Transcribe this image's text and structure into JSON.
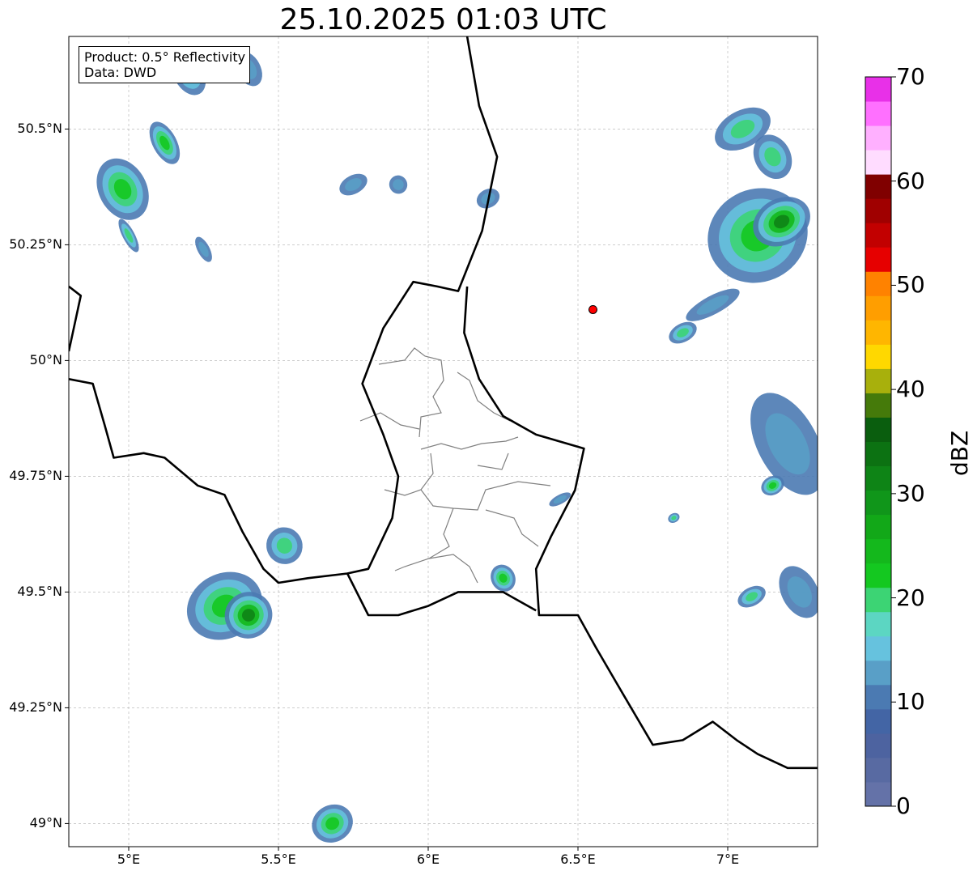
{
  "title": "25.10.2025 01:03 UTC",
  "legend": {
    "product": "Product: 0.5° Reflectivity",
    "source": "Data: DWD"
  },
  "map": {
    "extent": {
      "lon": [
        4.8,
        7.3
      ],
      "lat": [
        48.95,
        50.7
      ]
    },
    "lon_ticks": [
      {
        "value": 5.0,
        "label": "5°E"
      },
      {
        "value": 5.5,
        "label": "5.5°E"
      },
      {
        "value": 6.0,
        "label": "6°E"
      },
      {
        "value": 6.5,
        "label": "6.5°E"
      },
      {
        "value": 7.0,
        "label": "7°E"
      }
    ],
    "lat_ticks": [
      {
        "value": 50.5,
        "label": "50.5°N"
      },
      {
        "value": 50.25,
        "label": "50.25°N"
      },
      {
        "value": 50.0,
        "label": "50°N"
      },
      {
        "value": 49.75,
        "label": "49.75°N"
      },
      {
        "value": 49.5,
        "label": "49.5°N"
      },
      {
        "value": 49.25,
        "label": "49.25°N"
      },
      {
        "value": 49.0,
        "label": "49°N"
      }
    ],
    "gridlines": true,
    "radar_site": {
      "lon": 6.55,
      "lat": 50.11,
      "color": "#ff0000"
    },
    "borders": [
      [
        [
          4.8,
          49.96
        ],
        [
          4.88,
          49.95
        ],
        [
          4.92,
          49.86
        ],
        [
          4.95,
          49.79
        ],
        [
          5.05,
          49.8
        ],
        [
          5.12,
          49.79
        ],
        [
          5.23,
          49.73
        ],
        [
          5.32,
          49.71
        ],
        [
          5.38,
          49.63
        ],
        [
          5.45,
          49.55
        ],
        [
          5.5,
          49.52
        ],
        [
          5.6,
          49.53
        ],
        [
          5.73,
          49.54
        ],
        [
          5.8,
          49.55
        ],
        [
          5.88,
          49.66
        ],
        [
          5.9,
          49.75
        ],
        [
          5.85,
          49.84
        ],
        [
          5.78,
          49.95
        ],
        [
          5.85,
          50.07
        ],
        [
          5.95,
          50.17
        ],
        [
          6.03,
          50.16
        ],
        [
          6.1,
          50.15
        ],
        [
          6.18,
          50.28
        ],
        [
          6.23,
          50.44
        ],
        [
          6.17,
          50.55
        ],
        [
          6.13,
          50.7
        ]
      ],
      [
        [
          6.13,
          50.16
        ],
        [
          6.12,
          50.06
        ],
        [
          6.17,
          49.96
        ],
        [
          6.25,
          49.88
        ],
        [
          6.36,
          49.84
        ],
        [
          6.52,
          49.81
        ],
        [
          6.49,
          49.72
        ],
        [
          6.41,
          49.62
        ],
        [
          6.36,
          49.55
        ],
        [
          6.37,
          49.45
        ],
        [
          6.5,
          49.45
        ],
        [
          6.56,
          49.38
        ],
        [
          6.65,
          49.28
        ],
        [
          6.75,
          49.17
        ],
        [
          6.85,
          49.18
        ],
        [
          6.95,
          49.22
        ],
        [
          7.03,
          49.18
        ],
        [
          7.1,
          49.15
        ],
        [
          7.2,
          49.12
        ],
        [
          7.3,
          49.12
        ]
      ],
      [
        [
          5.73,
          49.54
        ],
        [
          5.8,
          49.45
        ],
        [
          5.9,
          49.45
        ],
        [
          6.0,
          49.47
        ],
        [
          6.1,
          49.5
        ],
        [
          6.25,
          49.5
        ],
        [
          6.36,
          49.46
        ]
      ],
      [
        [
          4.8,
          50.16
        ],
        [
          4.84,
          50.14
        ],
        [
          4.82,
          50.08
        ],
        [
          4.8,
          50.02
        ]
      ]
    ],
    "cells": [
      {
        "lon": 5.32,
        "lat": 49.47,
        "rx": 0.13,
        "ry": 0.07,
        "level": 2
      },
      {
        "lon": 5.4,
        "lat": 49.45,
        "rx": 0.08,
        "ry": 0.05,
        "level": 3
      },
      {
        "lon": 5.52,
        "lat": 49.6,
        "rx": 0.06,
        "ry": 0.04,
        "level": 1
      },
      {
        "lon": 5.68,
        "lat": 49.0,
        "rx": 0.07,
        "ry": 0.04,
        "level": 2
      },
      {
        "lon": 4.98,
        "lat": 50.37,
        "rx": 0.08,
        "ry": 0.07,
        "level": 2
      },
      {
        "lon": 5.12,
        "lat": 50.47,
        "rx": 0.04,
        "ry": 0.05,
        "level": 2
      },
      {
        "lon": 5.2,
        "lat": 50.62,
        "rx": 0.05,
        "ry": 0.05,
        "level": 1
      },
      {
        "lon": 5.25,
        "lat": 50.24,
        "rx": 0.02,
        "ry": 0.03,
        "level": 0
      },
      {
        "lon": 5.0,
        "lat": 50.27,
        "rx": 0.02,
        "ry": 0.04,
        "level": 1
      },
      {
        "lon": 5.4,
        "lat": 50.63,
        "rx": 0.04,
        "ry": 0.04,
        "level": 0
      },
      {
        "lon": 6.25,
        "lat": 49.53,
        "rx": 0.04,
        "ry": 0.03,
        "level": 2
      },
      {
        "lon": 7.1,
        "lat": 50.27,
        "rx": 0.17,
        "ry": 0.1,
        "level": 2
      },
      {
        "lon": 7.18,
        "lat": 50.3,
        "rx": 0.1,
        "ry": 0.05,
        "level": 3
      },
      {
        "lon": 7.05,
        "lat": 50.5,
        "rx": 0.1,
        "ry": 0.04,
        "level": 1
      },
      {
        "lon": 7.15,
        "lat": 50.44,
        "rx": 0.06,
        "ry": 0.05,
        "level": 1
      },
      {
        "lon": 6.85,
        "lat": 50.06,
        "rx": 0.05,
        "ry": 0.02,
        "level": 1
      },
      {
        "lon": 6.95,
        "lat": 50.12,
        "rx": 0.1,
        "ry": 0.02,
        "level": 0
      },
      {
        "lon": 7.2,
        "lat": 49.82,
        "rx": 0.1,
        "ry": 0.12,
        "level": 0
      },
      {
        "lon": 7.15,
        "lat": 49.73,
        "rx": 0.04,
        "ry": 0.02,
        "level": 2
      },
      {
        "lon": 7.24,
        "lat": 49.5,
        "rx": 0.06,
        "ry": 0.06,
        "level": 0
      },
      {
        "lon": 7.08,
        "lat": 49.49,
        "rx": 0.05,
        "ry": 0.02,
        "level": 1
      },
      {
        "lon": 6.2,
        "lat": 50.35,
        "rx": 0.04,
        "ry": 0.02,
        "level": 0
      },
      {
        "lon": 5.75,
        "lat": 50.38,
        "rx": 0.05,
        "ry": 0.02,
        "level": 0
      },
      {
        "lon": 5.9,
        "lat": 50.38,
        "rx": 0.03,
        "ry": 0.02,
        "level": 0
      },
      {
        "lon": 6.44,
        "lat": 49.7,
        "rx": 0.04,
        "ry": 0.01,
        "level": 0
      },
      {
        "lon": 6.82,
        "lat": 49.66,
        "rx": 0.02,
        "ry": 0.01,
        "level": 1
      }
    ]
  },
  "colorbar": {
    "label": "dBZ",
    "min": 0,
    "max": 70,
    "ticks": [
      0,
      10,
      20,
      30,
      40,
      50,
      60,
      70
    ],
    "colors": [
      "#6472a8",
      "#586aa2",
      "#4d63a0",
      "#4365a5",
      "#4b7ab2",
      "#599fc7",
      "#66c2de",
      "#5cd6c2",
      "#3cd474",
      "#14c820",
      "#14b81c",
      "#12a818",
      "#10961a",
      "#0e8416",
      "#0c7212",
      "#0a5e0e",
      "#457a0a",
      "#a8b00c",
      "#ffd800",
      "#ffb600",
      "#ff9e00",
      "#ff8200",
      "#e60000",
      "#c20000",
      "#a00000",
      "#800000",
      "#ffdcff",
      "#ffb0ff",
      "#ff70ff",
      "#e830e8"
    ]
  }
}
